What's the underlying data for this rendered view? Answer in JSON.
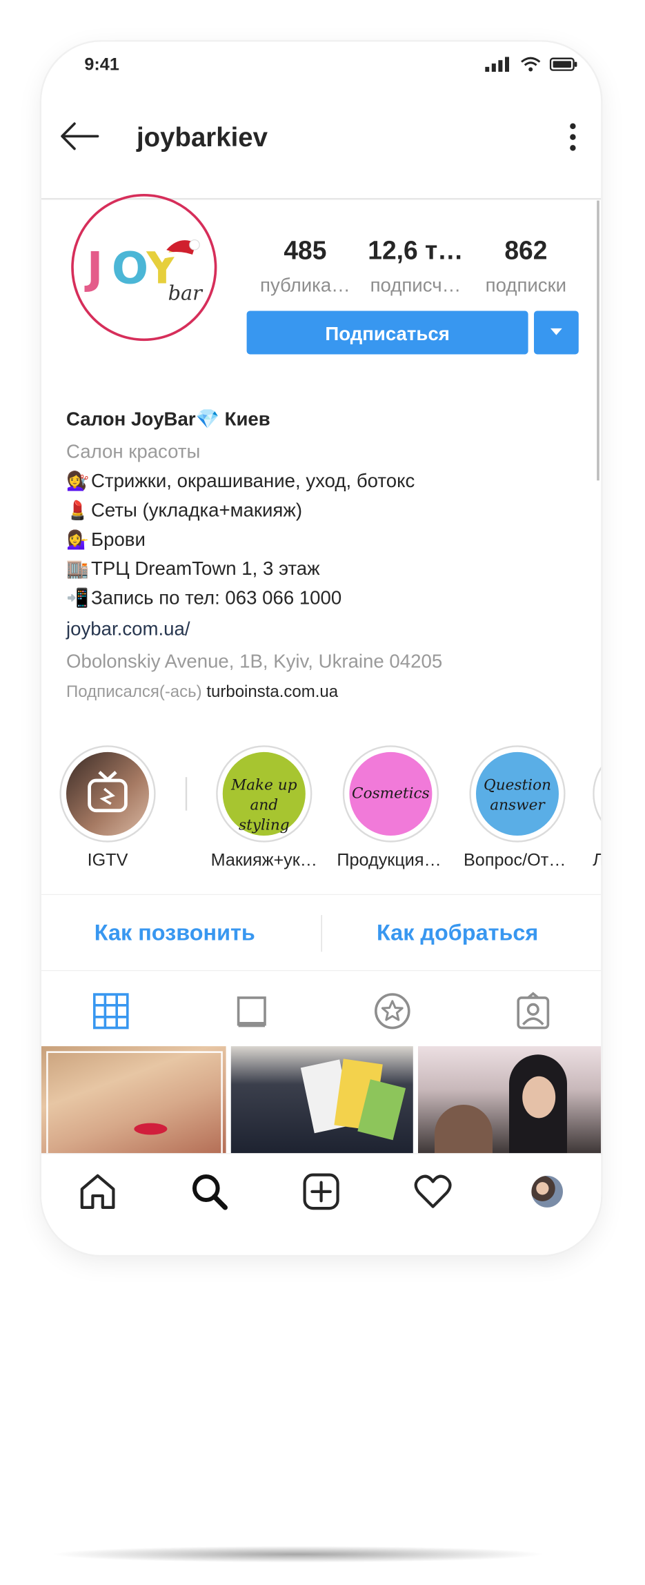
{
  "status": {
    "time": "9:41"
  },
  "header": {
    "username": "joybarkiev"
  },
  "profile": {
    "stats": [
      {
        "value": "485",
        "label": "публика…"
      },
      {
        "value": "12,6 т…",
        "label": "подписч…"
      },
      {
        "value": "862",
        "label": "подписки"
      }
    ],
    "follow_label": "Подписаться"
  },
  "bio": {
    "name": "Салон JoyBar💎 Киев",
    "category": "Салон красоты",
    "lines": [
      {
        "emoji": "💇‍♀️",
        "text": "Стрижки, окрашивание, уход, ботокс"
      },
      {
        "emoji": "💄",
        "text": "Сеты (укладка+макияж)"
      },
      {
        "emoji": "💁‍♀️",
        "text": "Брови"
      },
      {
        "emoji": "🏬",
        "text": "ТРЦ DreamTown 1, 3 этаж"
      },
      {
        "emoji": "📲",
        "text": "Запись по тел: 063 066 1000"
      }
    ],
    "link": "joybar.com.ua/",
    "address": "Obolonskiy Avenue, 1B, Kyiv, Ukraine 04205",
    "followed_prefix": "Подписался(-ась)",
    "followed_by": "turboinsta.com.ua"
  },
  "highlights": [
    {
      "label": "IGTV"
    },
    {
      "label": "Макияж+ук…",
      "cover": "Make up and styling",
      "color": "#a7c530"
    },
    {
      "label": "Продукция …",
      "cover": "Cosmetics",
      "color": "#f17ad9"
    },
    {
      "label": "Вопрос/Отв…",
      "cover": "Question answer",
      "color": "#5aaee6"
    },
    {
      "label": "Л"
    }
  ],
  "contacts": {
    "call": "Как позвонить",
    "directions": "Как добраться"
  },
  "colors": {
    "accent": "#3897f0",
    "ring": "#d62e5a"
  }
}
